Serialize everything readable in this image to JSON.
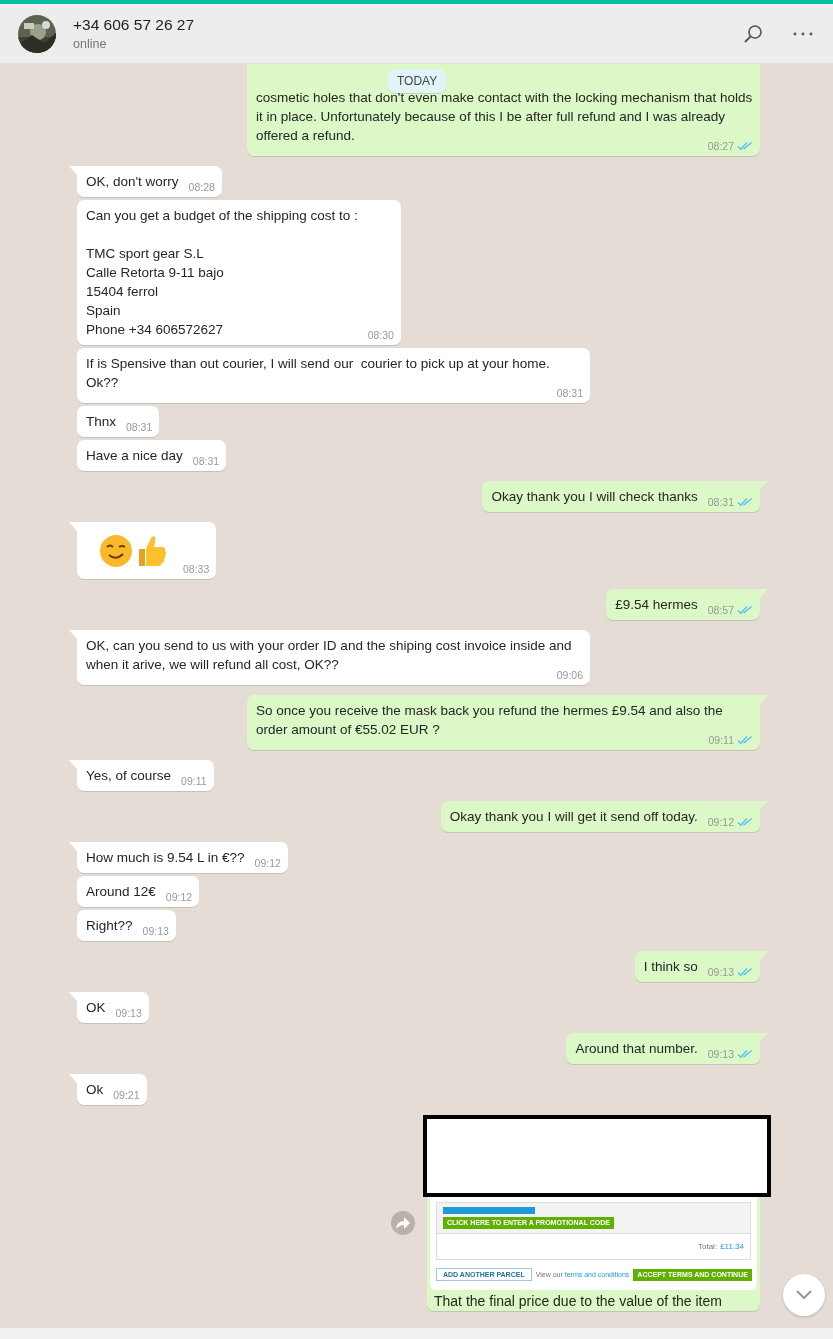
{
  "header": {
    "name": "+34 606 57 26 27",
    "status": "online"
  },
  "date_badge": "TODAY",
  "messages": [
    {
      "kind": "outgoing",
      "tail": false,
      "text": "cosmetic holes that don't even make contact with the locking mechanism that holds it in place. Unfortunately because of this I be after full refund and I was already offered a refund.",
      "time": "08:27",
      "read": true
    },
    {
      "kind": "incoming",
      "tail": true,
      "text": "OK, don't worry",
      "time": "08:28"
    },
    {
      "kind": "incoming",
      "tail": false,
      "text": "Can you get a budget of the shipping cost to :\n\nTMC sport gear S.L\nCalle Retorta 9-11 bajo\n15404 ferrol\nSpain\nPhone +34 606572627",
      "time": "08:30"
    },
    {
      "kind": "incoming",
      "tail": false,
      "text": "If is Spensive than out courier, I will send our  courier to pick up at your home. Ok??",
      "time": "08:31"
    },
    {
      "kind": "incoming",
      "tail": false,
      "text": "Thnx",
      "time": "08:31"
    },
    {
      "kind": "incoming",
      "tail": false,
      "text": "Have a nice day",
      "time": "08:31"
    },
    {
      "kind": "outgoing",
      "tail": true,
      "text": "Okay thank you I will check thanks",
      "time": "08:31",
      "read": true
    },
    {
      "kind": "emoji",
      "tail": true,
      "time": "08:33"
    },
    {
      "kind": "outgoing",
      "tail": true,
      "text": "£9.54 hermes",
      "time": "08:57",
      "read": true
    },
    {
      "kind": "incoming",
      "tail": true,
      "text": "OK, can you send to us with your order ID and the shiping cost invoice inside and when it arive, we will refund all cost, OK??",
      "time": "09:06"
    },
    {
      "kind": "outgoing",
      "tail": true,
      "text": "So once you receive the mask back you refund the hermes £9.54 and also the order amount of €55.02 EUR ?",
      "time": "09:11",
      "read": true
    },
    {
      "kind": "incoming",
      "tail": true,
      "text": "Yes, of course",
      "time": "09:11"
    },
    {
      "kind": "outgoing",
      "tail": true,
      "text": "Okay thank you I will get it send off today.",
      "time": "09:12",
      "read": true
    },
    {
      "kind": "incoming",
      "tail": true,
      "text": "How much is 9.54 L in €??",
      "time": "09:12"
    },
    {
      "kind": "incoming",
      "tail": false,
      "text": "Around 12€",
      "time": "09:12"
    },
    {
      "kind": "incoming",
      "tail": false,
      "text": "Right??",
      "time": "09:13"
    },
    {
      "kind": "outgoing",
      "tail": true,
      "text": "I think so",
      "time": "09:13",
      "read": true
    },
    {
      "kind": "incoming",
      "tail": true,
      "text": "OK",
      "time": "09:13"
    },
    {
      "kind": "outgoing",
      "tail": true,
      "text": "Around that number.",
      "time": "09:13",
      "read": true
    },
    {
      "kind": "incoming",
      "tail": true,
      "text": "Ok",
      "time": "09:21"
    },
    {
      "screenshot": {
        "promo_button": "CLICK HERE TO ENTER A PROMOTIONAL CODE",
        "total_label": "Total:",
        "total": "£11.34",
        "add_parcel": "ADD ANOTHER PARCEL",
        "terms_prefix": "View our",
        "terms_link": "terms and conditions",
        "accept_button": "ACCEPT TERMS AND CONTINUE"
      },
      "caption": "That the final price due to the value of the item"
    }
  ]
}
